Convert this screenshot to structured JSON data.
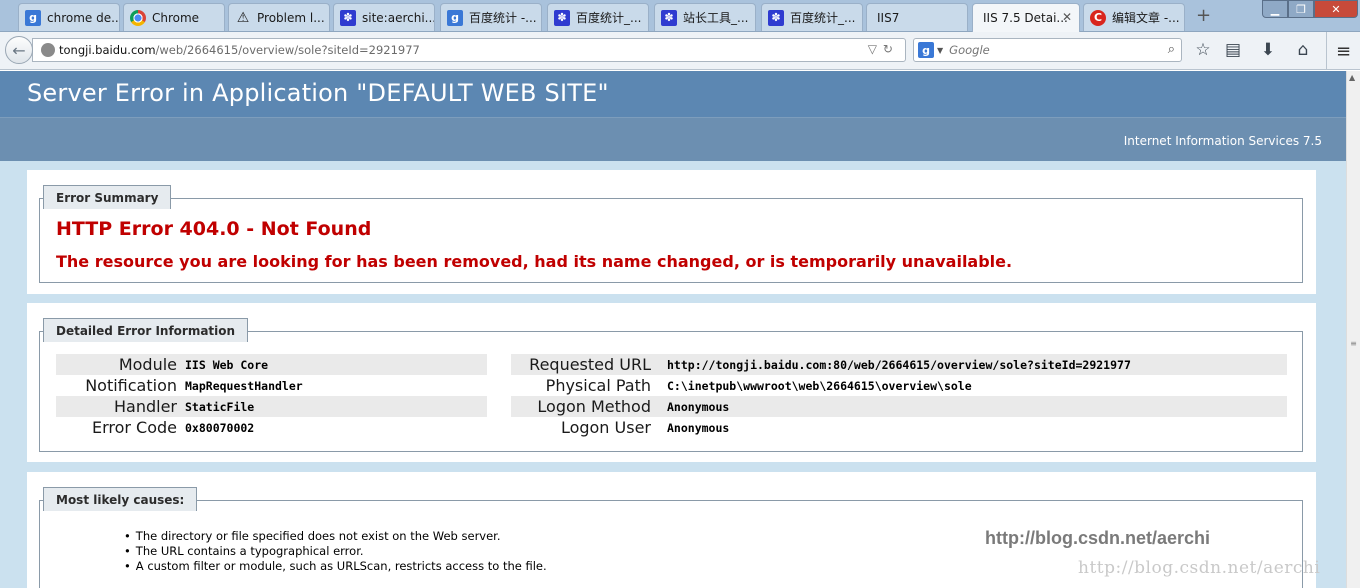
{
  "browser": {
    "tabs": [
      {
        "label": "chrome de...",
        "icon": "google-icon"
      },
      {
        "label": "Chrome",
        "icon": "chrome-icon"
      },
      {
        "label": "Problem l...",
        "icon": "warning-icon"
      },
      {
        "label": "site:aerchi....",
        "icon": "baidu-paw-icon"
      },
      {
        "label": "百度统计 -...",
        "icon": "google-icon"
      },
      {
        "label": "百度统计_...",
        "icon": "baidu-paw-icon"
      },
      {
        "label": "站长工具_...",
        "icon": "baidu-paw-icon"
      },
      {
        "label": "百度统计_...",
        "icon": "baidu-paw-icon"
      },
      {
        "label": "IIS7",
        "icon": ""
      },
      {
        "label": "IIS 7.5 Detai...",
        "icon": "",
        "active": true
      },
      {
        "label": "编辑文章 -...",
        "icon": "csdn-icon"
      }
    ],
    "url_host": "tongji.baidu.com",
    "url_path": "/web/2664615/overview/sole?siteId=2921977",
    "url_scheme_hidden": "tongji.",
    "search_placeholder": "Google",
    "colors": {
      "tabstrip": "#a9c2dc",
      "header": "#5c87b2",
      "error_red": "#c00000"
    }
  },
  "page": {
    "title": "Server Error in Application \"DEFAULT WEB SITE\"",
    "server": "Internet Information Services 7.5",
    "summary": {
      "legend": "Error Summary",
      "error_title": "HTTP Error 404.0 - Not Found",
      "error_description": "The resource you are looking for has been removed, had its name changed, or is temporarily unavailable."
    },
    "details": {
      "legend": "Detailed Error Information",
      "left": [
        {
          "label": "Module",
          "value": "IIS Web Core"
        },
        {
          "label": "Notification",
          "value": "MapRequestHandler"
        },
        {
          "label": "Handler",
          "value": "StaticFile"
        },
        {
          "label": "Error Code",
          "value": "0x80070002"
        }
      ],
      "right": [
        {
          "label": "Requested URL",
          "value": "http://tongji.baidu.com:80/web/2664615/overview/sole?siteId=2921977"
        },
        {
          "label": "Physical Path",
          "value": "C:\\inetpub\\wwwroot\\web\\2664615\\overview\\sole"
        },
        {
          "label": "Logon Method",
          "value": "Anonymous"
        },
        {
          "label": "Logon User",
          "value": "Anonymous"
        }
      ]
    },
    "causes": {
      "legend": "Most likely causes:",
      "items": [
        "The directory or file specified does not exist on the Web server.",
        "The URL contains a typographical error.",
        "A custom filter or module, such as URLScan, restricts access to the file."
      ]
    },
    "watermark_main": "http://blog.csdn.net/aerchi",
    "watermark_faint": "http://blog.csdn.net/aerchi"
  }
}
